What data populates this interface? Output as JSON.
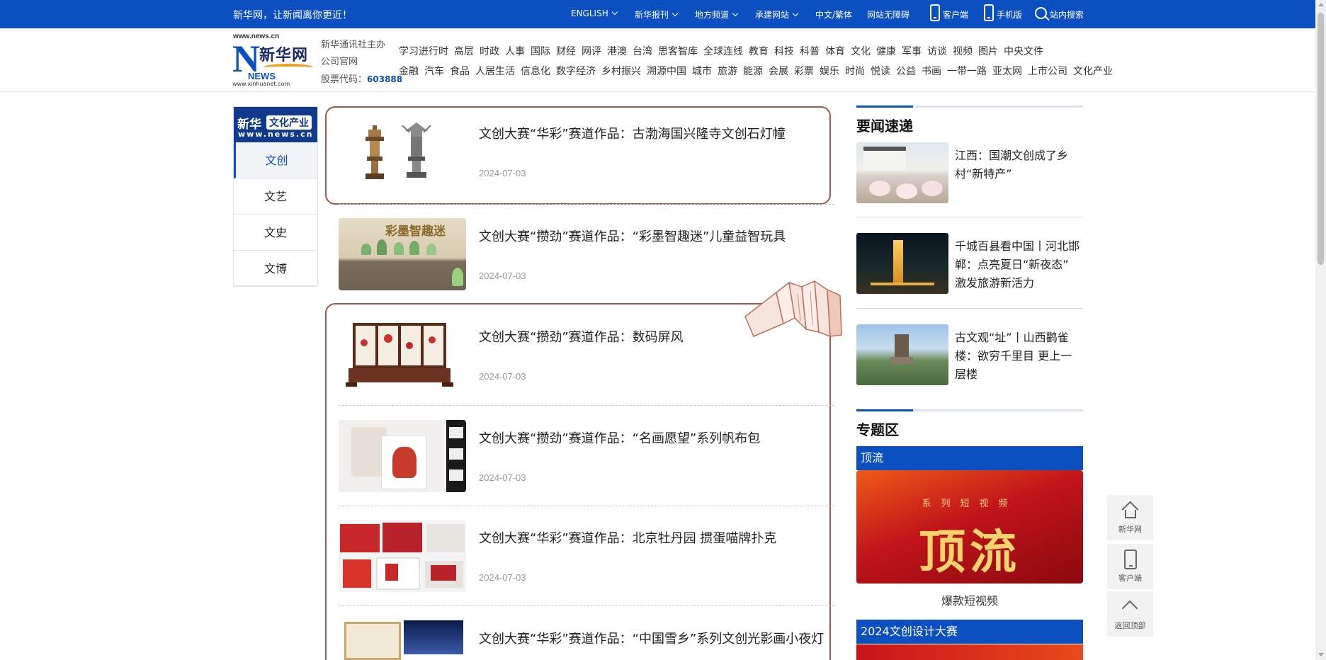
{
  "topbar": {
    "slogan": "新华网，让新闻离你更近！",
    "links": [
      "ENGLISH",
      "新华报刊",
      "地方频道",
      "承建网站",
      "中文/繁体",
      "网站无障碍",
      "客户端",
      "手机版",
      "站内搜索"
    ]
  },
  "header": {
    "logo": {
      "url_top": "www.news.cn",
      "name": "新华网",
      "news": "NEWS",
      "url_bottom": "www.xinhuanet.com"
    },
    "info": {
      "line1": "新华通讯社主办",
      "line2": "公司官网",
      "stock_label": "股票代码：",
      "stock_code": "603888"
    },
    "channels_row1": [
      "学习进行时",
      "高层",
      "时政",
      "人事",
      "国际",
      "财经",
      "网评",
      "港澳",
      "台湾",
      "思客智库",
      "全球连线",
      "教育",
      "科技",
      "科普",
      "体育",
      "文化",
      "健康",
      "军事",
      "访谈",
      "视频",
      "图片",
      "中央文件"
    ],
    "channels_row2": [
      "金融",
      "汽车",
      "食品",
      "人居生活",
      "信息化",
      "数字经济",
      "乡村振兴",
      "溯源中国",
      "城市",
      "旅游",
      "能源",
      "会展",
      "彩票",
      "娱乐",
      "时尚",
      "悦读",
      "公益",
      "书画",
      "一带一路",
      "亚太网",
      "上市公司",
      "文化产业"
    ]
  },
  "leftnav": {
    "brand": {
      "b1": "新华",
      "b2": "文化产业",
      "b3": "www.news.cn"
    },
    "items": [
      {
        "label": "文创"
      },
      {
        "label": "文艺"
      },
      {
        "label": "文史"
      },
      {
        "label": "文博"
      }
    ]
  },
  "articles": [
    {
      "title": "文创大赛“华彩”赛道作品：古渤海国兴隆寺文创石灯幢",
      "date": "2024-07-03"
    },
    {
      "title": "文创大赛“攒劲”赛道作品：“彩墨智趣迷”儿童益智玩具",
      "date": "2024-07-03"
    },
    {
      "title": "文创大赛“攒劲”赛道作品：数码屏风",
      "date": "2024-07-03"
    },
    {
      "title": "文创大赛“攒劲”赛道作品：“名画愿望”系列帆布包",
      "date": "2024-07-03"
    },
    {
      "title": "文创大赛“华彩”赛道作品：北京牡丹园 掼蛋喵牌扑克",
      "date": "2024-07-03"
    },
    {
      "title": "文创大赛“华彩”赛道作品：“中国雪乡”系列文创光影画小夜灯",
      "date": ""
    }
  ],
  "thumb_texts": {
    "puzzle": "彩墨智趣迷"
  },
  "right": {
    "headlines_title": "要闻速递",
    "headlines": [
      {
        "text": "江西：国潮文创成了乡村“新特产”"
      },
      {
        "text": "千城百县看中国丨河北邯郸：点亮夏日“新夜态” 激发旅游新活力"
      },
      {
        "text": "古文观“址”丨山西鹳雀楼：欲穷千里目 更上一层楼"
      }
    ],
    "topics_title": "专题区",
    "topic1": {
      "bar": "顶流",
      "banner_sub": "系列短视频",
      "banner_big": "顶流",
      "caption": "爆款短视频"
    },
    "topic2": {
      "bar": "2024文创设计大赛"
    }
  },
  "float_tools": [
    {
      "label": "新华网",
      "icon": "home-icon"
    },
    {
      "label": "客户端",
      "icon": "device-icon"
    },
    {
      "label": "返回顶部",
      "icon": "chevron-up-icon"
    }
  ],
  "colors": {
    "brand_blue": "#0b4fc0",
    "frame_brown": "#9b5a4a",
    "topic_red": "#c0141a"
  }
}
